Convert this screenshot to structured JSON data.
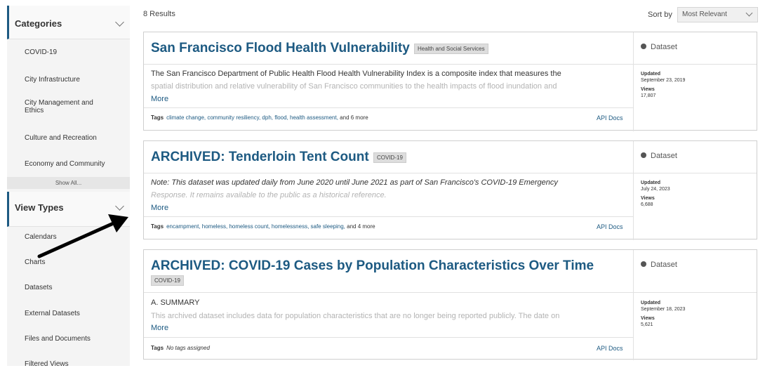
{
  "sidebar": {
    "categories_title": "Categories",
    "categories": [
      "COVID-19",
      "City Infrastructure",
      "City Management and Ethics",
      "Culture and Recreation",
      "Economy and Community"
    ],
    "show_all": "Show All...",
    "view_types_title": "View Types",
    "view_types": [
      "Calendars",
      "Charts",
      "Datasets",
      "External Datasets",
      "Files and Documents",
      "Filtered Views"
    ]
  },
  "results": {
    "count": "8 Results",
    "sort_label": "Sort by",
    "sort_value": "Most Relevant"
  },
  "cards": [
    {
      "title": "San Francisco Flood Health Vulnerability",
      "badge": "Health and Social Services",
      "desc_line1": "The San Francisco Department of Public Health Flood Health Vulnerability Index is a composite index that measures the",
      "desc_line2": "spatial distribution and relative vulnerability of San Francisco communities to the health impacts of flood inundation and",
      "more": "More",
      "tags_label": "Tags",
      "tags": "climate change, community resiliency, dph, flood, health assessment,",
      "tags_more": "and 6 more",
      "api": "API Docs",
      "type": "Dataset",
      "updated_label": "Updated",
      "updated": "September 23, 2019",
      "views_label": "Views",
      "views": "17,807"
    },
    {
      "title": "ARCHIVED: Tenderloin Tent Count",
      "badge": "COVID-19",
      "desc_line1": "Note: This dataset was updated daily from June 2020 until June 2021 as part of San Francisco's COVID-19 Emergency",
      "desc_line2": "Response. It remains available to the public as a historical reference.",
      "more": "More",
      "tags_label": "Tags",
      "tags": "encampment, homeless, homeless count, homelessness, safe sleeping,",
      "tags_more": "and 4 more",
      "api": "API Docs",
      "type": "Dataset",
      "updated_label": "Updated",
      "updated": "July 24, 2023",
      "views_label": "Views",
      "views": "6,688"
    },
    {
      "title": "ARCHIVED: COVID-19 Cases by Population Characteristics Over Time",
      "badge": "COVID-19",
      "desc_line1": "A. SUMMARY",
      "desc_line2": "This archived dataset includes data for population characteristics that are no longer being reported publicly. The date on",
      "more": "More",
      "tags_label": "Tags",
      "tags": "No tags assigned",
      "api": "API Docs",
      "type": "Dataset",
      "updated_label": "Updated",
      "updated": "September 18, 2023",
      "views_label": "Views",
      "views": "5,621"
    }
  ],
  "colors": {
    "accent": "#1d5a82",
    "sidebar_bg": "#f4f4f4",
    "badge_bg": "#dddddd",
    "arrow": "#000000"
  }
}
